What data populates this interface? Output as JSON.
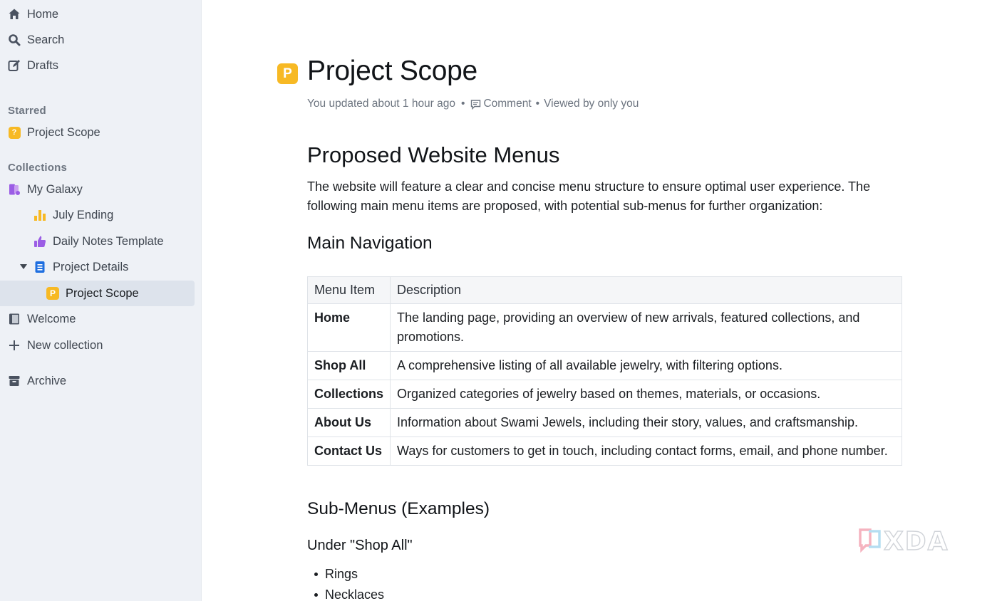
{
  "sidebar": {
    "nav": [
      {
        "label": "Home",
        "icon": "home-icon"
      },
      {
        "label": "Search",
        "icon": "search-icon"
      },
      {
        "label": "Drafts",
        "icon": "edit-icon"
      }
    ],
    "starred_label": "Starred",
    "starred": [
      {
        "label": "Project Scope",
        "icon": "question-badge-icon"
      }
    ],
    "collections_label": "Collections",
    "collections": [
      {
        "label": "My Galaxy",
        "icon": "collection-icon"
      },
      {
        "label": "July Ending",
        "icon": "bar-chart-icon"
      },
      {
        "label": "Daily Notes Template",
        "icon": "thumbs-up-icon"
      },
      {
        "label": "Project Details",
        "icon": "document-icon"
      },
      {
        "label": "Project Scope",
        "icon": "p-badge-icon",
        "active": true
      },
      {
        "label": "Welcome",
        "icon": "book-icon"
      },
      {
        "label": "New collection",
        "icon": "plus-icon"
      }
    ],
    "archive": {
      "label": "Archive",
      "icon": "archive-icon"
    }
  },
  "doc": {
    "icon_letter": "P",
    "title": "Project Scope",
    "meta": {
      "updated": "You updated about 1 hour ago",
      "comment": "Comment",
      "viewed": "Viewed by only you"
    },
    "h1": "Proposed Website Menus",
    "intro": "The website will feature a clear and concise menu structure to ensure optimal user experience. The following main menu items are proposed, with potential sub-menus for further organization:",
    "h2_main_nav": "Main Navigation",
    "table": {
      "headers": [
        "Menu Item",
        "Description"
      ],
      "rows": [
        [
          "Home",
          "The landing page, providing an overview of new arrivals, featured collections, and promotions."
        ],
        [
          "Shop All",
          "A comprehensive listing of all available jewelry, with filtering options."
        ],
        [
          "Collections",
          "Organized categories of jewelry based on themes, materials, or occasions."
        ],
        [
          "About Us",
          "Information about Swami Jewels, including their story, values, and craftsmanship."
        ],
        [
          "Contact Us",
          "Ways for customers to get in touch, including contact forms, email, and phone number."
        ]
      ]
    },
    "h2_submenus": "Sub-Menus (Examples)",
    "h3_shop_all": "Under \"Shop All\"",
    "bullets": [
      "Rings",
      "Necklaces"
    ]
  },
  "colors": {
    "accent_badge": "#f7b924",
    "sidebar_bg": "#eef1f6",
    "active_row": "#dde3ec"
  },
  "watermark_text": "XDA"
}
